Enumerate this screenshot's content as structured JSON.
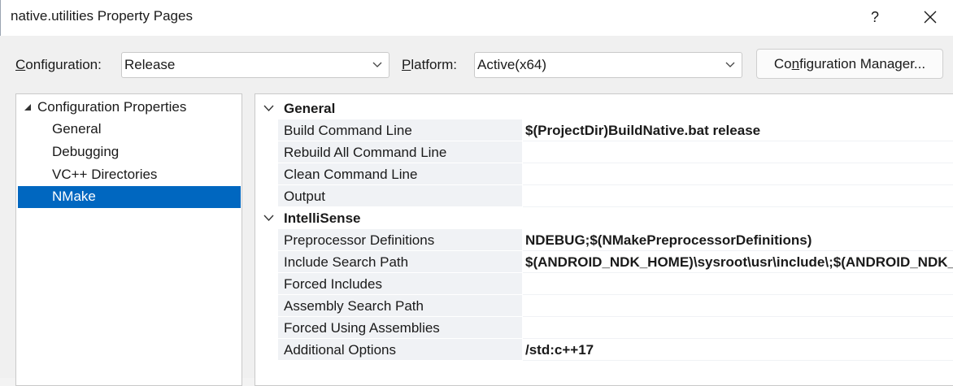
{
  "window": {
    "title": "native.utilities Property Pages",
    "help_label": "?"
  },
  "toolbar": {
    "configuration_label_accel": "C",
    "configuration_label_rest": "onfiguration:",
    "configuration_value": "Release",
    "platform_label_accel": "P",
    "platform_label_rest": "latform:",
    "platform_value": "Active(x64)",
    "config_manager_pre": "Co",
    "config_manager_accel": "n",
    "config_manager_post": "figuration Manager..."
  },
  "tree": {
    "root_label": "Configuration Properties",
    "items": [
      {
        "label": "General"
      },
      {
        "label": "Debugging"
      },
      {
        "label": "VC++ Directories"
      },
      {
        "label": "NMake"
      }
    ],
    "selected_index": 3
  },
  "grid": {
    "categories": [
      {
        "label": "General",
        "properties": [
          {
            "name": "Build Command Line",
            "value": "$(ProjectDir)BuildNative.bat release"
          },
          {
            "name": "Rebuild All Command Line",
            "value": ""
          },
          {
            "name": "Clean Command Line",
            "value": ""
          },
          {
            "name": "Output",
            "value": ""
          }
        ]
      },
      {
        "label": "IntelliSense",
        "properties": [
          {
            "name": "Preprocessor Definitions",
            "value": "NDEBUG;$(NMakePreprocessorDefinitions)"
          },
          {
            "name": "Include Search Path",
            "value": "$(ANDROID_NDK_HOME)\\sysroot\\usr\\include\\;$(ANDROID_NDK_HOME)"
          },
          {
            "name": "Forced Includes",
            "value": ""
          },
          {
            "name": "Assembly Search Path",
            "value": ""
          },
          {
            "name": "Forced Using Assemblies",
            "value": ""
          },
          {
            "name": "Additional Options",
            "value": "/std:c++17"
          }
        ]
      }
    ]
  },
  "icons": {
    "close": "close-icon",
    "dropdown": "chevron-down-icon",
    "tree_expanded": "triangle-expanded-icon",
    "category_collapse": "chevron-down-icon"
  },
  "colors": {
    "selection": "#0067c0",
    "name_cell_bg": "#f0f2f5"
  }
}
